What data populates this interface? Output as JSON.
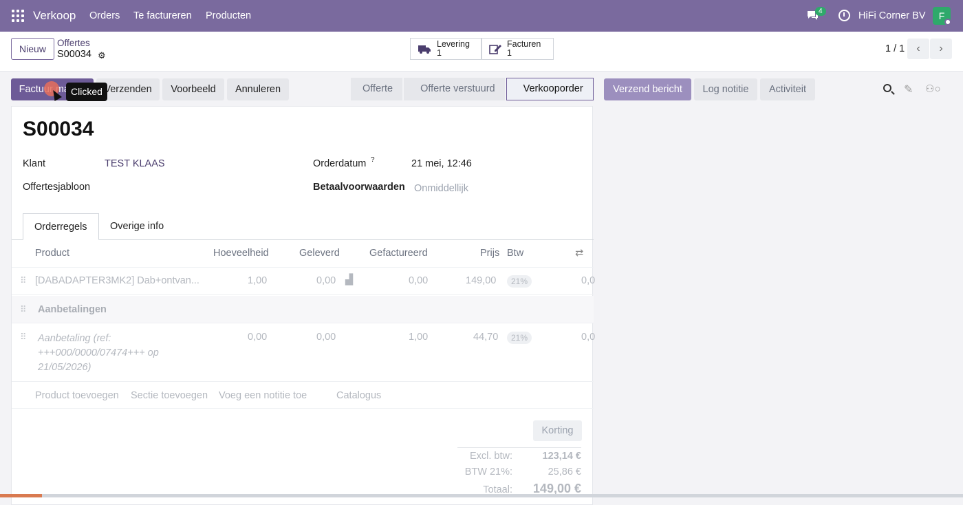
{
  "topnav": {
    "app_name": "Verkoop",
    "menu": [
      "Orders",
      "Te factureren",
      "Producten"
    ],
    "chat_count": "4",
    "company": "HiFi Corner BV",
    "avatar_initial": "F",
    "bg_color": "#7a6a9e"
  },
  "control_panel": {
    "new_label": "Nieuw",
    "breadcrumb_parent": "Offertes",
    "breadcrumb_current": "S00034",
    "smart_buttons": [
      {
        "icon": "truck-icon",
        "label": "Levering",
        "count": "1"
      },
      {
        "icon": "edit-icon",
        "label": "Facturen",
        "count": "1"
      }
    ],
    "pager": "1 / 1"
  },
  "actions": {
    "create_invoice_label": "Factuur maken",
    "send_label": "Verzenden",
    "preview_label": "Voorbeeld",
    "cancel_label": "Annuleren",
    "tooltip": "Clicked"
  },
  "statusbar": {
    "stages": [
      "Offerte",
      "Offerte verstuurd",
      "Verkooporder"
    ],
    "active": "Verkooporder"
  },
  "chatter": {
    "send_message": "Verzend bericht",
    "log_note": "Log notitie",
    "activity": "Activiteit"
  },
  "form": {
    "name": "S00034",
    "customer_label": "Klant",
    "customer_value": "TEST KLAAS",
    "template_label": "Offertesjabloon",
    "order_date_label": "Orderdatum",
    "order_date_help": "?",
    "order_date_value": "21 mei, 12:46",
    "payment_terms_label": "Betaalvoorwaarden",
    "payment_terms_placeholder": "Onmiddellijk"
  },
  "tabs": [
    "Orderregels",
    "Overige info"
  ],
  "lines": {
    "headers": [
      "Product",
      "Hoeveelheid",
      "Geleverd",
      "Gefactureerd",
      "Prijs",
      "Btw"
    ],
    "rows": [
      {
        "product": "[DABADAPTER3MK2] Dab+ontvan...",
        "qty": "1,00",
        "delivered": "0,00",
        "invoiced": "0,00",
        "price": "149,00",
        "tax": "21%",
        "subtotal": "0,0"
      },
      {
        "section": "Aanbetalingen"
      },
      {
        "product_lines": [
          "Aanbetaling (ref:",
          "+++000/0000/07474+++ op",
          "21/05/2026)"
        ],
        "qty": "0,00",
        "delivered": "0,00",
        "invoiced": "1,00",
        "price": "44,70",
        "tax": "21%",
        "subtotal": "0,0"
      }
    ],
    "add_links": [
      "Product toevoegen",
      "Sectie toevoegen",
      "Voeg een notitie toe",
      "Catalogus"
    ]
  },
  "totals": {
    "discount_label": "Korting",
    "untaxed_label": "Excl. btw:",
    "untaxed_value": "123,14 €",
    "tax_label": "BTW 21%:",
    "tax_value": "25,86 €",
    "total_label": "Totaal:",
    "total_value": "149,00 €"
  }
}
